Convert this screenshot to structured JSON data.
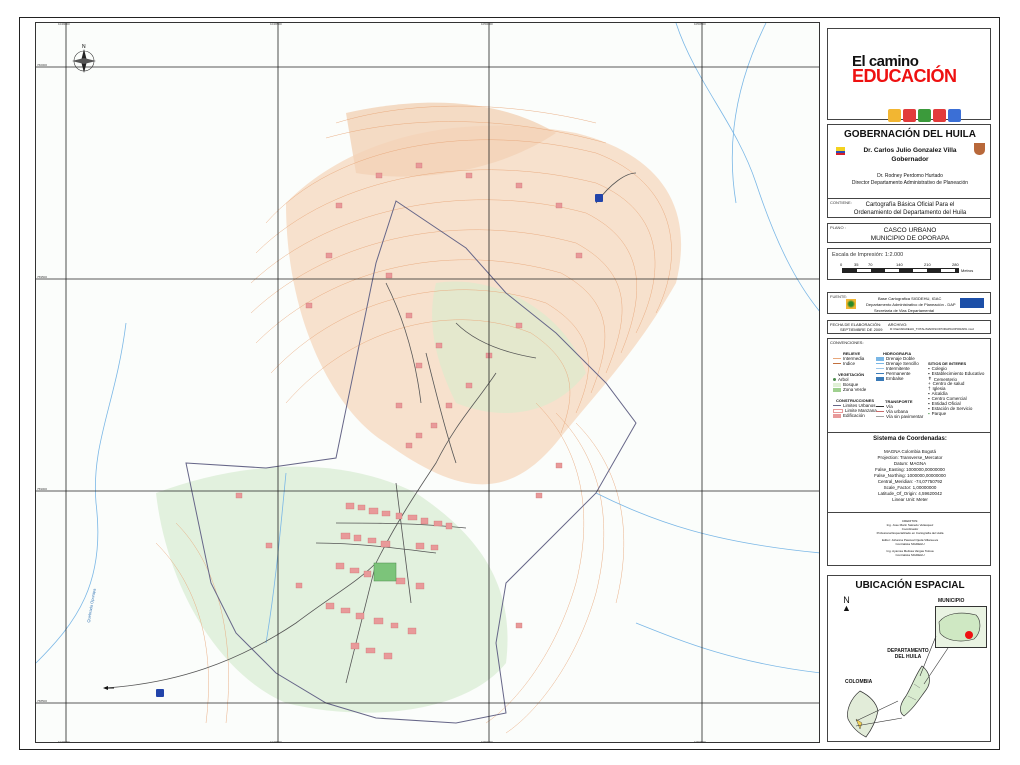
{
  "map": {
    "top_ticks": [
      "1049000",
      "1049500",
      "1050000",
      "1050500"
    ],
    "left_ticks": [
      "760000",
      "759500",
      "759000",
      "758500"
    ],
    "river_label": "Quebrada Oporapa",
    "road_label": "Vía",
    "colors": {
      "contour": "#e8a77a",
      "hillshade": "#f6dcc4",
      "vegetation": "#cde8c6",
      "buildings": "#e89a9a",
      "roads": "#555555",
      "rivers": "#7ab7e6",
      "boundary": "#666688"
    }
  },
  "logo": {
    "line1": "El camino",
    "line2": "EDUCACIÓN"
  },
  "header": {
    "title": "GOBERNACIÓN DEL HUILA",
    "governor_name": "Dr. Carlos Julio Gonzalez Villa",
    "governor_role": "Gobernador",
    "director_name": "Dr. Rodney Perdomo Hurtado",
    "director_role": "Director Departamento Administrativo de Planeación"
  },
  "contiene": {
    "label": "CONTIENE:",
    "line1": "Cartografía Básica Oficial Para el",
    "line2": "Ordenamiento del Departamento del Huila"
  },
  "plano": {
    "label": "PLANO :",
    "line1": "CASCO URBANO",
    "line2": "MUNICIPIO DE OPORAPA"
  },
  "scale": {
    "title": "Escala de Impresión: 1:2.000",
    "ticks": [
      "0",
      "35",
      "70",
      "140",
      "210",
      "280"
    ],
    "unit": "Metros"
  },
  "fuente": {
    "label": "FUENTE:",
    "line1": "Base Cartografica SIGDEHU, IGAC",
    "line2": "Departamento Administrativo de Planeación - DAP",
    "line3": "Secretaria de Vias Departamental"
  },
  "fecha": {
    "label": "FECHA DE ELABORACIÓN:",
    "value": "SEPTIEMBRE DE 2009",
    "archivo_label": "ARCHIVO:",
    "archivo_value": "D:\\Vias\\SIGDEHU_TOTAL\\MAPAS\\OPORAPA\\OPORAPA.mxd"
  },
  "legend": {
    "label": "CONVENCIONES:",
    "relieve": {
      "title": "RELIEVE",
      "items": [
        "Intermedia",
        "Indice"
      ]
    },
    "vegetacion": {
      "title": "VEGETACIÓN",
      "items": [
        "Arbol",
        "Bosque",
        "Zona Verde"
      ]
    },
    "construcciones": {
      "title": "CONSTRUCCIONES",
      "items": [
        "Limites Urbanos",
        "Limite Manzana",
        "Edificación"
      ]
    },
    "hidrografia": {
      "title": "HIDROGRAFIA",
      "items": [
        "Drenaje Doble",
        "Drenaje Sencillo",
        "Intermitente",
        "Permanente",
        "Embalse"
      ]
    },
    "transporte": {
      "title": "TRANSPORTE",
      "items": [
        "Vía",
        "Vía urbana",
        "Vía sin pavimentar"
      ]
    },
    "sitios": {
      "title": "SITIOS DE INTERES",
      "items": [
        "Colegio",
        "Establecimiento Educativo",
        "Cementerio",
        "Centro de salud",
        "Iglesia",
        "Alcaldía",
        "Centro Comercial",
        "Entidad Oficial",
        "Estación de Servicio",
        "Parque"
      ]
    }
  },
  "coords": {
    "title": "Sistema de Coordenadas:",
    "lines": [
      "MAGNA Colombia Bogotá",
      "Projection: Transverse_Mercator",
      "Datum: MAGNA",
      "False_Easting: 1000000,00000000",
      "False_Northing: 1000000,00000000",
      "Central_Meridian: -74,07750792",
      "Scale_Factor: 1,00000000",
      "Latitude_Of_Origin: 4,59620042",
      "Linear Unit: Meter"
    ]
  },
  "credits": {
    "lines": [
      "CREDITOS:",
      "Ing. Jose Marin Salcedo Velasquez",
      "Coordinador",
      "Profesional Especializado en Cartografía del Huila",
      "",
      "Editor: Johanna Pascual Ojeda Villanueva",
      "Contratista SIGDEHU",
      "",
      "Ing. Ayamsa Melissa Vargas Tolosa",
      "Contratista SIGDEHU"
    ]
  },
  "ubicacion": {
    "title": "UBICACIÓN ESPACIAL",
    "municipio": "MUNICIPIO",
    "departamento_line1": "DEPARTAMENTO",
    "departamento_line2": "DEL HUILA",
    "colombia": "COLOMBIA"
  }
}
